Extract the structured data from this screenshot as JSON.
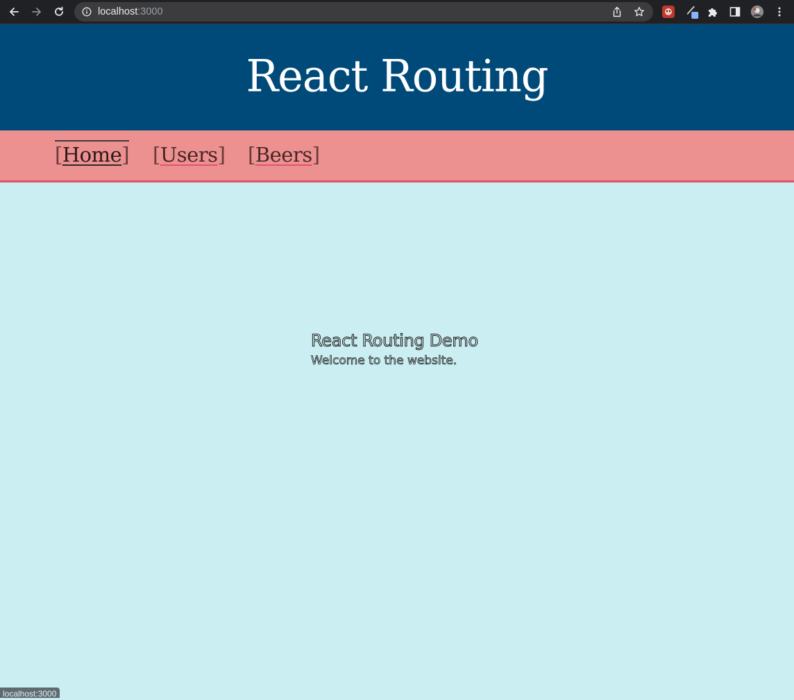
{
  "browser": {
    "url_host": "localhost",
    "url_port": ":3000",
    "status_text": "localhost:3000",
    "icons": {
      "back": "back-arrow-icon",
      "forward": "forward-arrow-icon",
      "reload": "reload-icon",
      "site_info": "info-icon",
      "share": "share-icon",
      "bookmark": "star-icon",
      "extensions": [
        "red-extension-icon",
        "pen-extension-icon",
        "puzzle-icon"
      ],
      "side_panel": "side-panel-icon",
      "profile": "avatar",
      "menu": "kebab-menu-icon"
    }
  },
  "header": {
    "title": "React Routing"
  },
  "nav": {
    "items": [
      {
        "open": "[",
        "label": "Home",
        "close": "]",
        "active": true
      },
      {
        "open": "[",
        "label": "Users",
        "close": "]",
        "active": false
      },
      {
        "open": "[",
        "label": "Beers",
        "close": "]",
        "active": false
      }
    ]
  },
  "main": {
    "heading": "React Routing Demo",
    "text": "Welcome to the website."
  },
  "colors": {
    "header_bg": "#004a7a",
    "nav_bg": "#ec9190",
    "nav_border": "#e0506a",
    "page_bg": "#cbeef2"
  }
}
